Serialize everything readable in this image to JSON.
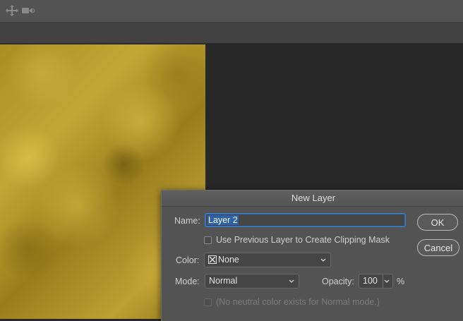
{
  "toolbar": {
    "icons": [
      "move-arrows-icon",
      "video-camera-icon"
    ]
  },
  "dialog": {
    "title": "New Layer",
    "name_label": "Name:",
    "name_value": "Layer 2",
    "clipping_checkbox_label": "Use Previous Layer to Create Clipping Mask",
    "clipping_checked": false,
    "color_label": "Color:",
    "color_value": "None",
    "mode_label": "Mode:",
    "mode_value": "Normal",
    "opacity_label": "Opacity:",
    "opacity_value": "100",
    "opacity_unit": "%",
    "neutral_label": "(No neutral color exists for Normal mode.)",
    "neutral_checked": false,
    "ok_label": "OK",
    "cancel_label": "Cancel"
  },
  "colors": {
    "panel": "#535353",
    "background": "#282828",
    "selection": "#2e62a8",
    "gold": "#b89c2e"
  }
}
